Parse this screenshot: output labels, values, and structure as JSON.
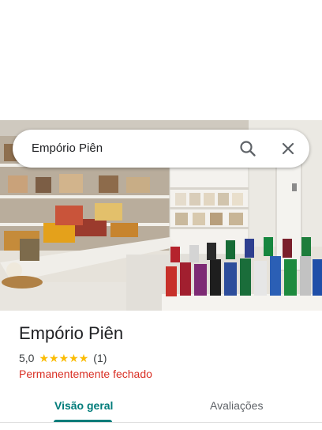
{
  "search": {
    "query": "Empório Piên"
  },
  "place": {
    "name": "Empório Piên",
    "rating": "5,0",
    "stars": 5,
    "review_count": "(1)",
    "status": "Permanentemente fechado"
  },
  "tabs": [
    {
      "label": "Visão geral",
      "active": true
    },
    {
      "label": "Avaliações",
      "active": false
    }
  ],
  "colors": {
    "accent": "#017c7a",
    "status_closed": "#d93025",
    "star": "#fbbc04"
  }
}
